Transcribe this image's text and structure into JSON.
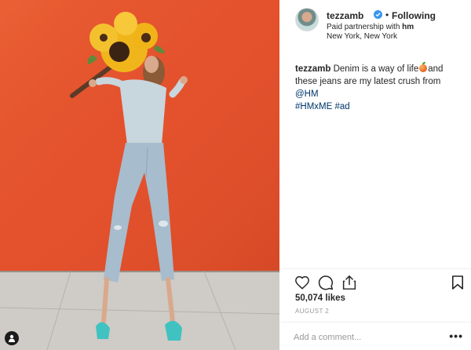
{
  "post": {
    "username": "tezzamb",
    "follow_status": "Following",
    "dot": "•",
    "partnership_prefix": "Paid partnership with ",
    "partner": "hm",
    "location": "New York, New York"
  },
  "caption": {
    "user": "tezzamb",
    "text_before": "Denim is a way of life",
    "emoji": "peach",
    "text_after": "and these jeans are my latest crush from ",
    "mention": "@HM",
    "hashtag1": "#HMxME",
    "hashtag2": "#ad"
  },
  "stats": {
    "likes": "50,074 likes",
    "date": "AUGUST 2"
  },
  "comment": {
    "placeholder": "Add a comment...",
    "more": "•••"
  },
  "icons": {
    "like": "heart-icon",
    "comment": "comment-icon",
    "share": "share-icon",
    "save": "bookmark-icon",
    "tag": "user-tag-icon",
    "verified": "verified-badge-icon"
  },
  "colors": {
    "wall": "#e4532e",
    "sidewalk": "#cfcbc6",
    "link": "#003569",
    "verified": "#3897f0",
    "muted": "#999999"
  }
}
